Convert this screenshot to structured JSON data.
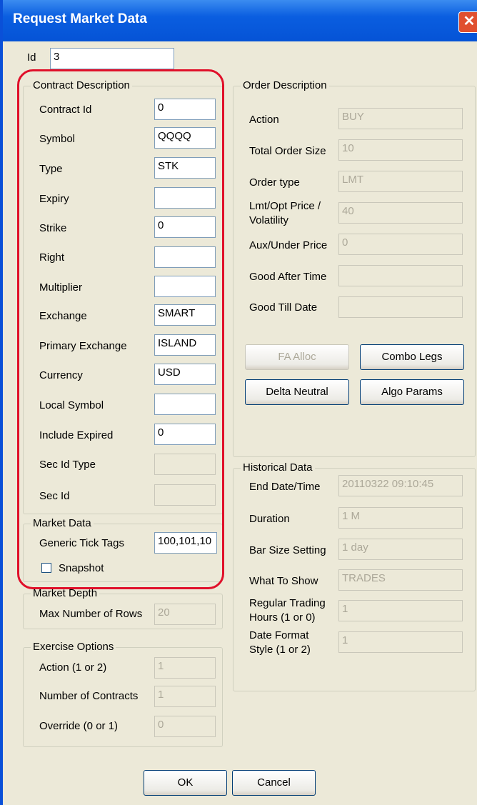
{
  "window": {
    "title": "Request Market Data",
    "close_glyph": "✕"
  },
  "id_field": {
    "label": "Id",
    "value": "3"
  },
  "contract": {
    "title": "Contract Description",
    "contract_id": {
      "label": "Contract Id",
      "value": "0"
    },
    "symbol": {
      "label": "Symbol",
      "value": "QQQQ"
    },
    "type": {
      "label": "Type",
      "value": "STK"
    },
    "expiry": {
      "label": "Expiry",
      "value": ""
    },
    "strike": {
      "label": "Strike",
      "value": "0"
    },
    "right": {
      "label": "Right",
      "value": ""
    },
    "multiplier": {
      "label": "Multiplier",
      "value": ""
    },
    "exchange": {
      "label": "Exchange",
      "value": "SMART"
    },
    "primary_exchange": {
      "label": "Primary Exchange",
      "value": "ISLAND"
    },
    "currency": {
      "label": "Currency",
      "value": "USD"
    },
    "local_symbol": {
      "label": "Local Symbol",
      "value": ""
    },
    "include_expired": {
      "label": "Include Expired",
      "value": "0"
    },
    "sec_id_type": {
      "label": "Sec Id Type",
      "value": ""
    },
    "sec_id": {
      "label": "Sec Id",
      "value": ""
    }
  },
  "market_data": {
    "title": "Market Data",
    "generic_tick_tags": {
      "label": "Generic Tick Tags",
      "value": "100,101,10"
    },
    "snapshot": {
      "label": "Snapshot",
      "checked": false
    }
  },
  "market_depth": {
    "title": "Market Depth",
    "max_rows": {
      "label": "Max Number of Rows",
      "value": "20"
    }
  },
  "exercise": {
    "title": "Exercise Options",
    "action": {
      "label": "Action (1 or 2)",
      "value": "1"
    },
    "num_contracts": {
      "label": "Number of Contracts",
      "value": "1"
    },
    "override": {
      "label": "Override (0 or 1)",
      "value": "0"
    }
  },
  "order": {
    "title": "Order Description",
    "action": {
      "label": "Action",
      "value": "BUY"
    },
    "total_size": {
      "label": "Total Order Size",
      "value": "10"
    },
    "order_type": {
      "label": "Order type",
      "value": "LMT"
    },
    "lmt_price": {
      "label_1": "Lmt/Opt Price /",
      "label_2": "Volatility",
      "value": "40"
    },
    "aux_price": {
      "label": "Aux/Under Price",
      "value": "0"
    },
    "good_after": {
      "label": "Good After Time",
      "value": ""
    },
    "good_till": {
      "label": "Good Till Date",
      "value": ""
    },
    "buttons": {
      "fa_alloc": "FA Alloc",
      "combo_legs": "Combo Legs",
      "delta_neutral": "Delta Neutral",
      "algo_params": "Algo Params"
    }
  },
  "historical": {
    "title": "Historical Data",
    "end_datetime": {
      "label": "End Date/Time",
      "value": "20110322 09:10:45"
    },
    "duration": {
      "label": "Duration",
      "value": "1 M"
    },
    "bar_size": {
      "label": "Bar Size Setting",
      "value": "1 day"
    },
    "what_to_show": {
      "label": "What To Show",
      "value": "TRADES"
    },
    "rth": {
      "label_1": "Regular Trading",
      "label_2": "Hours (1 or 0)",
      "value": "1"
    },
    "date_format": {
      "label_1": "Date Format",
      "label_2": "Style (1 or 2)",
      "value": "1"
    }
  },
  "footer": {
    "ok": "OK",
    "cancel": "Cancel"
  }
}
